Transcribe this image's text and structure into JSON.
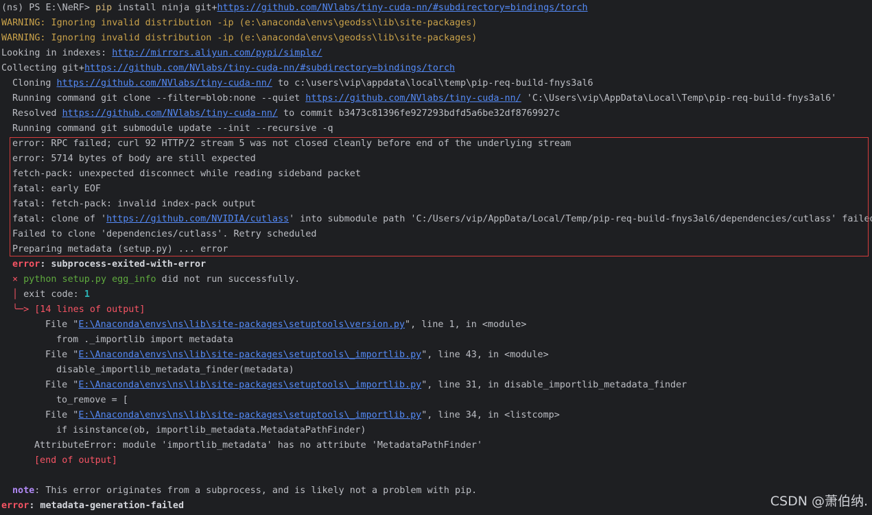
{
  "terminal": {
    "l1": {
      "prompt": "(ns) PS E:\\NeRF> ",
      "cmd": "pip",
      "text": " install ninja git+",
      "url": "https://github.com/NVlabs/tiny-cuda-nn/#subdirectory=bindings/torch"
    },
    "l2": "WARNING: Ignoring invalid distribution -ip (e:\\anaconda\\envs\\geodss\\lib\\site-packages)",
    "l3": "WARNING: Ignoring invalid distribution -ip (e:\\anaconda\\envs\\geodss\\lib\\site-packages)",
    "l4": {
      "text": "Looking in indexes: ",
      "url": "http://mirrors.aliyun.com/pypi/simple/"
    },
    "l5": {
      "text": "Collecting git+",
      "url": "https://github.com/NVlabs/tiny-cuda-nn/#subdirectory=bindings/torch"
    },
    "l6": {
      "a": "Cloning ",
      "url": "https://github.com/NVlabs/tiny-cuda-nn/",
      "b": " to c:\\users\\vip\\appdata\\local\\temp\\pip-req-build-fnys3al6"
    },
    "l7": {
      "a": "Running command git clone --filter=blob:none --quiet ",
      "url": "https://github.com/NVlabs/tiny-cuda-nn/",
      "b": " 'C:\\Users\\vip\\AppData\\Local\\Temp\\pip-req-build-fnys3al6'"
    },
    "l8": {
      "a": "Resolved ",
      "url": "https://github.com/NVlabs/tiny-cuda-nn/",
      "b": " to commit b3473c81396fe927293bdfd5a6be32df8769927c"
    },
    "l9": "Running command git submodule update --init --recursive -q",
    "l10": "error: RPC failed; curl 92 HTTP/2 stream 5 was not closed cleanly before end of the underlying stream",
    "l11": "error: 5714 bytes of body are still expected",
    "l12": "fetch-pack: unexpected disconnect while reading sideband packet",
    "l13": "fatal: early EOF",
    "l14": "fatal: fetch-pack: invalid index-pack output",
    "l15": {
      "a": "fatal: clone of '",
      "url": "https://github.com/NVIDIA/cutlass",
      "b": "' into submodule path 'C:/Users/vip/AppData/Local/Temp/pip-req-build-fnys3al6/dependencies/cutlass' failed"
    },
    "l16": "Failed to clone 'dependencies/cutlass'. Retry scheduled",
    "l17": "Preparing metadata (setup.py) ... error",
    "l18": {
      "a": "error",
      "b": ": subprocess-exited-with-error"
    },
    "l19": {
      "x": "×",
      "cmd": " python setup.py egg_info",
      "b": " did not run successfully."
    },
    "l20": {
      "bar": "│",
      "a": " exit code: ",
      "code": "1"
    },
    "l21": {
      "arrow": "╰─>",
      "b": " [14 lines of output]"
    },
    "l22": {
      "a": "File \"",
      "url": "E:\\Anaconda\\envs\\ns\\lib\\site-packages\\setuptools\\version.py",
      "b": "\", line 1, in <module>"
    },
    "l23": "from ._importlib import metadata",
    "l24": {
      "a": "File \"",
      "url": "E:\\Anaconda\\envs\\ns\\lib\\site-packages\\setuptools\\_importlib.py",
      "b": "\", line 43, in <module>"
    },
    "l25": "disable_importlib_metadata_finder(metadata)",
    "l26": {
      "a": "File \"",
      "url": "E:\\Anaconda\\envs\\ns\\lib\\site-packages\\setuptools\\_importlib.py",
      "b": "\", line 31, in disable_importlib_metadata_finder"
    },
    "l27": "to_remove = [",
    "l28": {
      "a": "File \"",
      "url": "E:\\Anaconda\\envs\\ns\\lib\\site-packages\\setuptools\\_importlib.py",
      "b": "\", line 34, in <listcomp>"
    },
    "l29": "if isinstance(ob, importlib_metadata.MetadataPathFinder)",
    "l30": "AttributeError: module 'importlib_metadata' has no attribute 'MetadataPathFinder'",
    "l31": "[end of output]",
    "l33": {
      "a": "note",
      "b": ": This error originates from a subprocess, and is likely not a problem with pip."
    },
    "l34": {
      "a": "error",
      "b": ": metadata-generation-failed"
    }
  },
  "watermark": "CSDN @萧伯纳.",
  "colors": {
    "background": "#1e1f22",
    "text": "#bcbec4",
    "link": "#548af7",
    "error": "#f75464",
    "warning": "#c9a24a",
    "highlight_box": "#d63c3c"
  }
}
